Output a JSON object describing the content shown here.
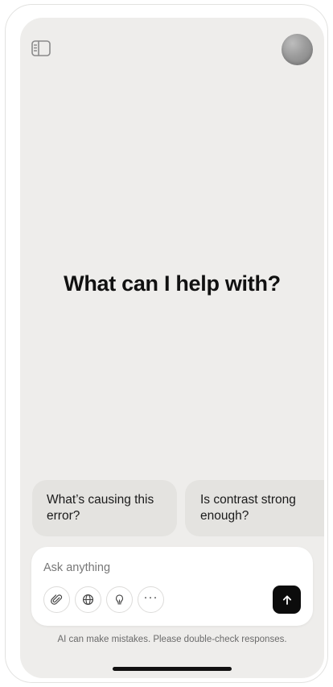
{
  "header": {
    "sidebar_icon": "sidebar-toggle-icon",
    "avatar_icon": "user-avatar"
  },
  "main": {
    "headline": "What can I help with?"
  },
  "suggestions": [
    {
      "label": "What’s causing this error?"
    },
    {
      "label": "Is contrast strong enough?"
    }
  ],
  "composer": {
    "placeholder": "Ask anything",
    "value": "",
    "tools": [
      {
        "icon": "paperclip-icon"
      },
      {
        "icon": "globe-icon"
      },
      {
        "icon": "lightbulb-icon"
      },
      {
        "icon": "more-icon",
        "glyph": "···"
      }
    ],
    "send_icon": "arrow-up-icon"
  },
  "footer": {
    "disclaimer": "AI can make mistakes. Please double-check responses."
  },
  "colors": {
    "background": "#eeedeb",
    "card": "#ffffff",
    "suggestion": "#e4e3e0",
    "accent": "#0c0c0c"
  }
}
